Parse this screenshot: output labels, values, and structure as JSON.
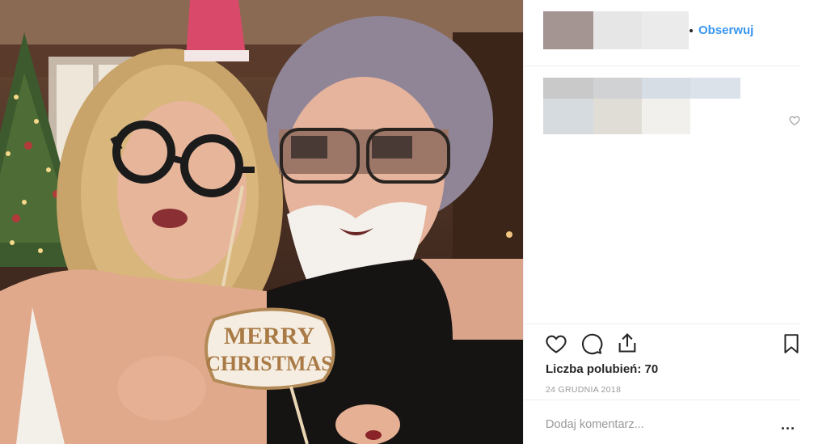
{
  "header": {
    "follow_label": "Obserwuj"
  },
  "post": {
    "likes_text": "Liczba polubień: 70",
    "date_text": "24 GRUDNIA 2018"
  },
  "photo": {
    "sign_text_line1": "MERRY",
    "sign_text_line2": "CHRISTMAS"
  },
  "comment": {
    "placeholder": "Dodaj komentarz...",
    "more_label": "..."
  },
  "icons": {
    "like": "heart-icon",
    "comment": "comment-bubble-icon",
    "share": "share-upload-icon",
    "save": "bookmark-icon",
    "small_like": "small-heart-icon"
  },
  "colors": {
    "link_blue": "#3897f0",
    "text_dark": "#262626",
    "text_muted": "#999999",
    "divider": "#efefef"
  }
}
